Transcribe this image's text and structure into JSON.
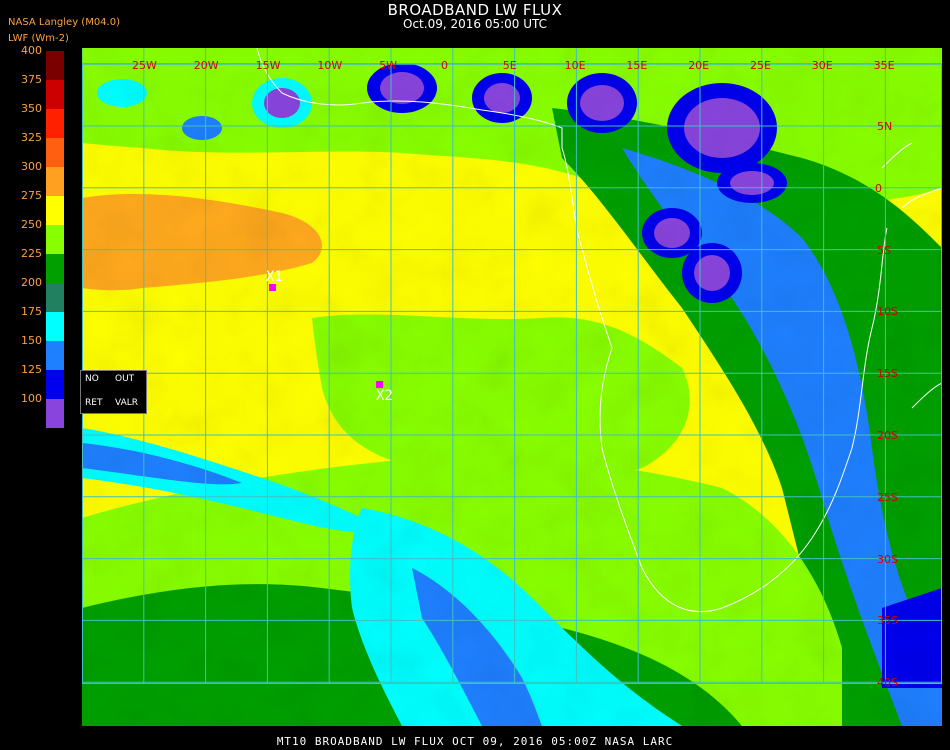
{
  "header": {
    "title": "BROADBAND LW FLUX",
    "subtitle": "Oct.09, 2016 05:00 UTC",
    "org": "NASA Langley (M04.0)",
    "units": "LWF (Wm-2)"
  },
  "colorbar": {
    "ticks": [
      "400",
      "375",
      "350",
      "325",
      "300",
      "275",
      "250",
      "225",
      "200",
      "175",
      "150",
      "125",
      "100"
    ],
    "bins": [
      {
        "color": "#7a0000"
      },
      {
        "color": "#cc0000"
      },
      {
        "color": "#ff2000"
      },
      {
        "color": "#ff6010"
      },
      {
        "color": "#ffa020"
      },
      {
        "color": "#ffff00"
      },
      {
        "color": "#88ff00"
      },
      {
        "color": "#00a000"
      },
      {
        "color": "#208060"
      },
      {
        "color": "#00ffff"
      },
      {
        "color": "#1e7fff"
      },
      {
        "color": "#0000ee"
      },
      {
        "color": "#8844dd"
      }
    ]
  },
  "map": {
    "lon_labels": [
      "25W",
      "20W",
      "15W",
      "10W",
      "5W",
      "0",
      "5E",
      "10E",
      "15E",
      "20E",
      "25E",
      "30E",
      "35E"
    ],
    "lat_labels": [
      "5N",
      "0",
      "5S",
      "10S",
      "15S",
      "20S",
      "25S",
      "30S",
      "35S",
      "40S"
    ],
    "grid_color": "#40c0c0",
    "markers": [
      {
        "label": "X1"
      },
      {
        "label": "X2"
      }
    ]
  },
  "legend_box": {
    "no": "NO",
    "out": "OUT",
    "ret": "RET",
    "valr": "VALR"
  },
  "footer": {
    "text": "MT10  BROADBAND LW FLUX   OCT 09, 2016 05:00Z   NASA LARC"
  }
}
